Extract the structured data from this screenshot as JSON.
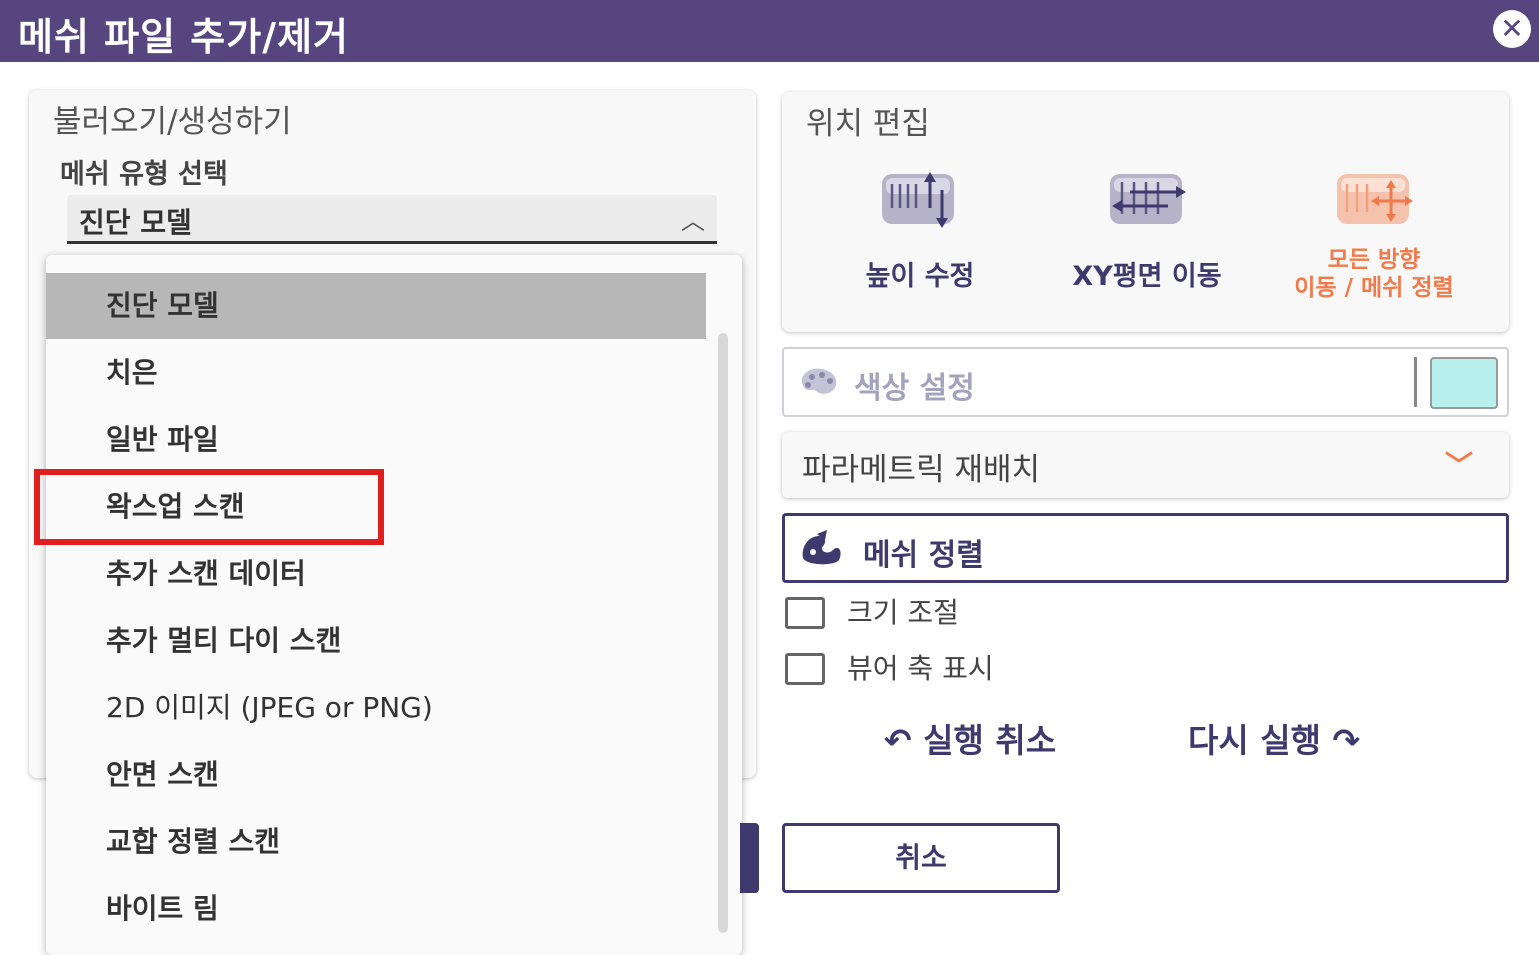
{
  "window": {
    "title": "메쉬 파일 추가/제거",
    "close_icon": "close-icon"
  },
  "load_panel": {
    "title": "불러오기/생성하기",
    "mesh_type_label": "메쉬 유형 선택",
    "selected_value": "진단 모델",
    "dropdown_items": [
      "진단 모델",
      "치은",
      "일반 파일",
      "왁스업 스캔",
      "추가 스캔 데이터",
      "추가 멀티 다이 스캔",
      "2D 이미지 (JPEG or PNG)",
      "안면 스캔",
      "교합 정렬 스캔",
      "바이트 림"
    ],
    "highlighted_item": "왁스업 스캔"
  },
  "position_panel": {
    "title": "위치 편집",
    "buttons": [
      {
        "label": "높이 수정",
        "icon": "height-adjust-icon"
      },
      {
        "label": "XY평면 이동",
        "icon": "xy-move-icon"
      },
      {
        "label_line1": "모든 방향",
        "label_line2": "이동 / 메쉬 정렬",
        "icon": "all-direction-move-icon"
      }
    ]
  },
  "color": {
    "label": "색상 설정",
    "swatch_color": "#b8f0ee",
    "icon": "palette-icon"
  },
  "param_select": {
    "label": "파라메트릭 재배치"
  },
  "mesh_align": {
    "label": "메쉬 정렬",
    "icon": "mesh-align-icon"
  },
  "checkboxes": [
    {
      "label": "크기 조절"
    },
    {
      "label": "뷰어 축 표시"
    }
  ],
  "undo": {
    "label": "실행 취소"
  },
  "redo": {
    "label": "다시 실행"
  },
  "cancel": {
    "label": "취소"
  },
  "colors": {
    "titlebar": "#56457f",
    "accent": "#3f3a6e",
    "orange": "#f07a4a",
    "highlight": "#e01e1e"
  }
}
